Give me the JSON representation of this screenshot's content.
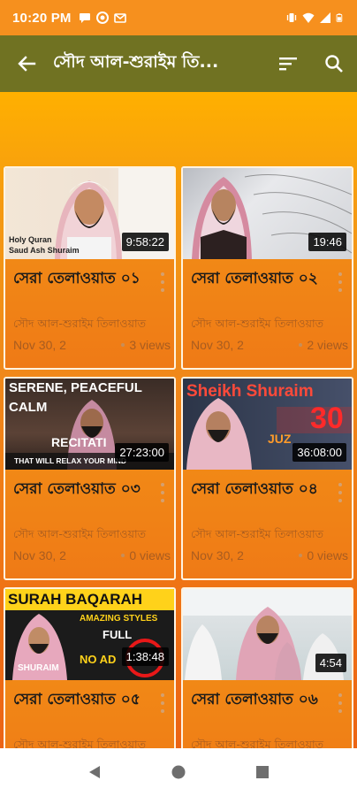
{
  "status_bar": {
    "time": "10:20 PM",
    "left_icons": [
      "chat-bubble-icon",
      "target-icon",
      "gmail-icon"
    ],
    "right_icons": [
      "vibrate-icon",
      "wifi-icon",
      "signal-icon",
      "battery-icon"
    ]
  },
  "app_bar": {
    "title": "সৌদ আল-শুরাইম তি...",
    "back_icon": "back-arrow-icon",
    "sort_icon": "sort-icon",
    "search_icon": "search-icon"
  },
  "videos": [
    {
      "title": "সেরা তেলাওয়াত ০১",
      "duration": "9:58:22",
      "channel": "সৌদ আল-শুরাইম তিলাওয়াত",
      "date": "Nov 30, 2",
      "views": "3 views",
      "thumb_caption": [
        "Holy Quran",
        "Saud Ash Shuraim"
      ]
    },
    {
      "title": "সেরা তেলাওয়াত ০২",
      "duration": "19:46",
      "channel": "সৌদ আল-শুরাইম তিলাওয়াত",
      "date": "Nov 30, 2",
      "views": "2 views",
      "thumb_caption": []
    },
    {
      "title": "সেরা তেলাওয়াত ০৩",
      "duration": "27:23:00",
      "channel": "সৌদ আল-শুরাইম তিলাওয়াত",
      "date": "Nov 30, 2",
      "views": "0 views",
      "thumb_caption": [
        "SERENE, PEACEFUL",
        "CALM",
        "RECITATI",
        "THAT WILL RELAX YOUR MIND"
      ]
    },
    {
      "title": "সেরা তেলাওয়াত ০৪",
      "duration": "36:08:00",
      "channel": "সৌদ আল-শুরাইম তিলাওয়াত",
      "date": "Nov 30, 2",
      "views": "0 views",
      "thumb_caption": [
        "Sheikh Shuraim",
        "JUZ",
        "30"
      ]
    },
    {
      "title": "সেরা তেলাওয়াত ০৫",
      "duration": "1:38:48",
      "channel": "সৌদ আল-শুরাইম তিলাওয়াত",
      "date": "",
      "views": "",
      "thumb_caption": [
        "SURAH BAQARAH",
        "AMAZING STYLES",
        "FULL",
        "NO AD",
        "SHURAIM"
      ]
    },
    {
      "title": "সেরা তেলাওয়াত ০৬",
      "duration": "4:54",
      "channel": "সৌদ আল-শুরাইম তিলাওয়াত",
      "date": "",
      "views": "",
      "thumb_caption": []
    }
  ],
  "nav_bar": {
    "back_icon": "nav-back-triangle-icon",
    "home_icon": "nav-home-circle-icon",
    "recents_icon": "nav-recents-square-icon"
  },
  "colors": {
    "status_bar": "#f6901e",
    "app_bar": "#707222",
    "content_top": "#ffb000",
    "content_bottom": "#ec6414"
  }
}
